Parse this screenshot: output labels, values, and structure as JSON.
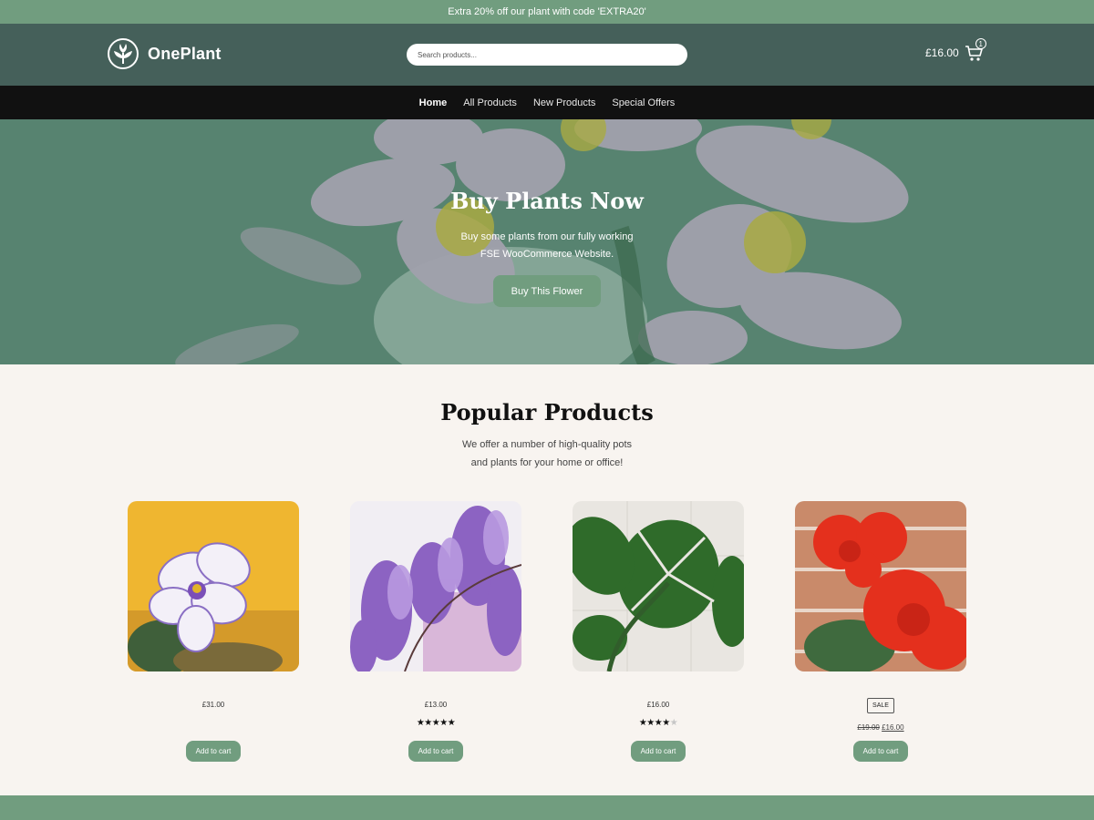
{
  "promo": {
    "text": "Extra 20% off our plant with code 'EXTRA20'"
  },
  "header": {
    "logo_text": "OnePlant",
    "logo_icon": "tulip-icon",
    "search_placeholder": "Search products...",
    "cart_total": "£16.00",
    "cart_count": "1",
    "cart_icon": "cart-icon"
  },
  "nav": {
    "items": [
      {
        "label": "Home",
        "active": true
      },
      {
        "label": "All Products",
        "active": false
      },
      {
        "label": "New Products",
        "active": false
      },
      {
        "label": "Special Offers",
        "active": false
      }
    ]
  },
  "hero": {
    "title": "Buy Plants Now",
    "text_line1": "Buy some plants from our fully working",
    "text_line2": "FSE WooCommerce Website.",
    "button_label": "Buy This Flower"
  },
  "popular": {
    "title": "Popular Products",
    "subtitle_line1": "We offer a number of high-quality pots",
    "subtitle_line2": "and plants for your home or office!"
  },
  "products": [
    {
      "image": "white-purple-violet-flower",
      "price": "£31.00",
      "rating": 0,
      "add_label": "Add to cart"
    },
    {
      "image": "wisteria-flowers",
      "price": "£13.00",
      "rating": 5,
      "add_label": "Add to cart"
    },
    {
      "image": "monstera-plant",
      "price": "£16.00",
      "rating": 4,
      "add_label": "Add to cart"
    },
    {
      "image": "red-geranium-flowers",
      "sale_badge": "SALE",
      "old_price": "£19.00",
      "new_price": "£16.00",
      "add_label": "Add to cart"
    }
  ],
  "colors": {
    "accent": "#719d7f",
    "header_bg": "#45605a",
    "nav_bg": "#111111",
    "page_bg": "#f8f4f0"
  }
}
